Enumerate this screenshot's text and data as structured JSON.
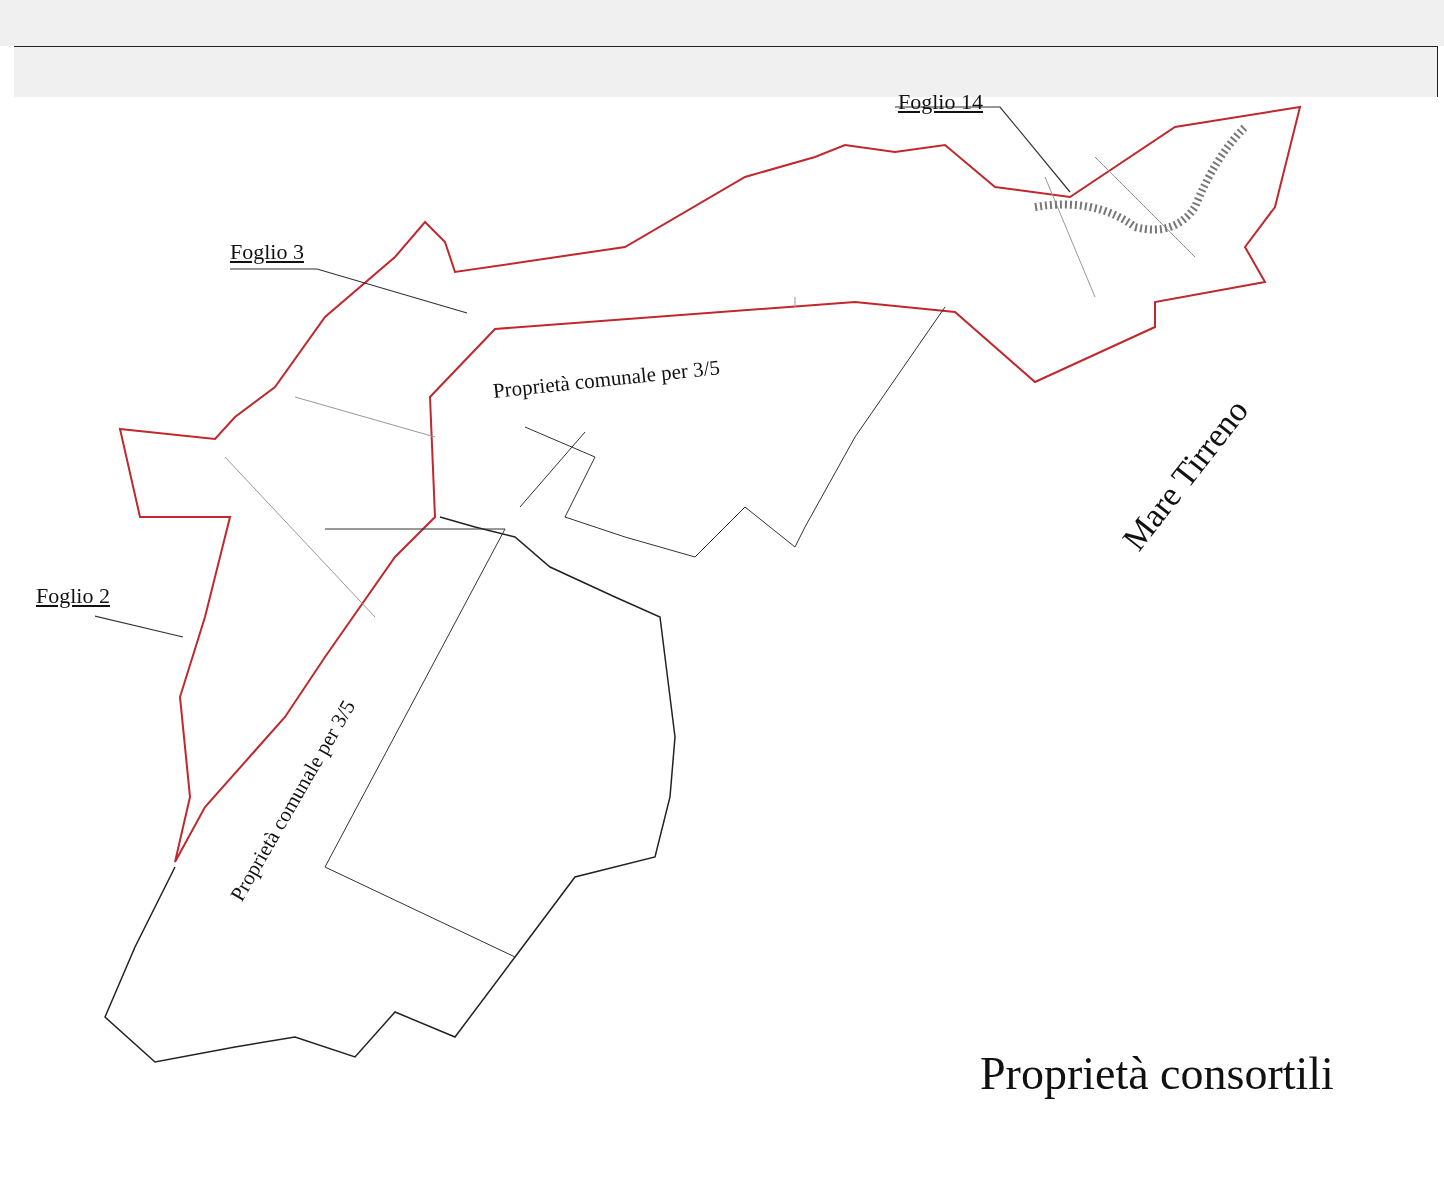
{
  "map": {
    "sheet_labels": [
      {
        "text": "Foglio 14"
      },
      {
        "text": "Foglio 3"
      },
      {
        "text": "Foglio 2"
      }
    ],
    "area_labels": [
      {
        "text": "Proprietà comunale per 3/5"
      },
      {
        "text": "Proprietà comunale per 3/5"
      }
    ],
    "sea_label": "Mare Tirreno",
    "caption": "Proprietà consortili"
  }
}
